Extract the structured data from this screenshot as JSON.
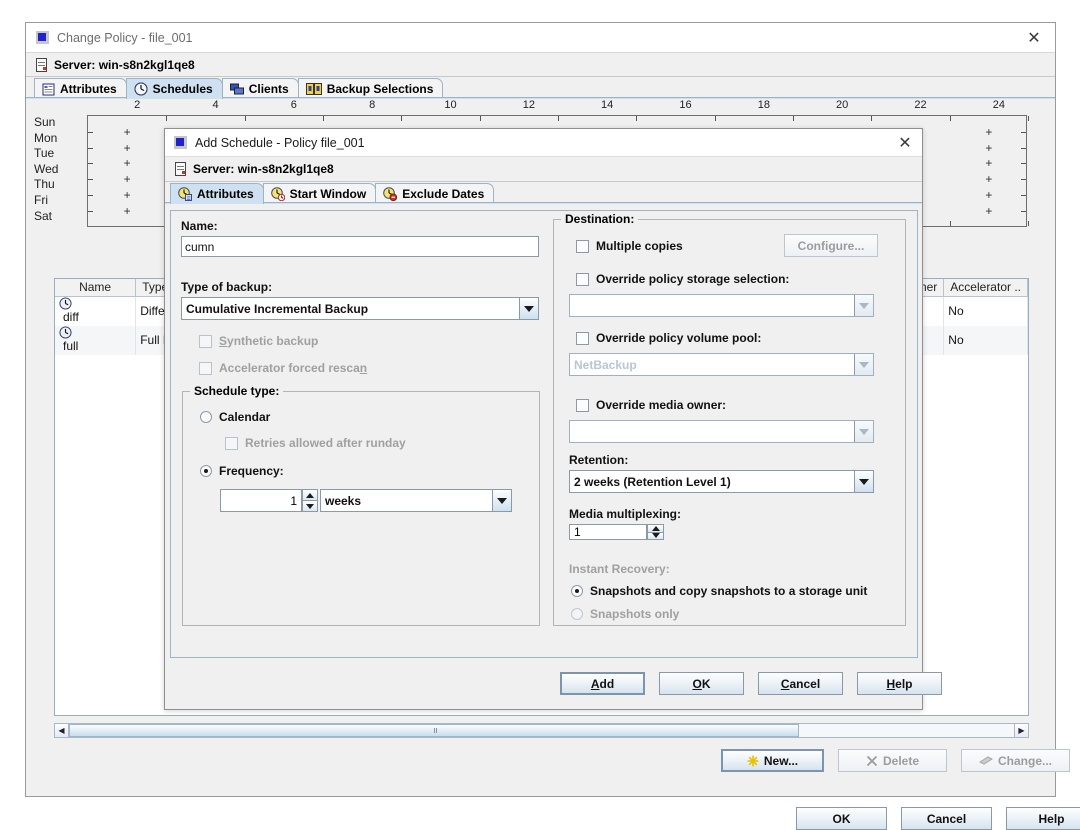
{
  "main_window": {
    "title": "Change Policy - file_001",
    "app_icon": "app-icon",
    "close_icon": "close-icon",
    "server_label": "Server: win-s8n2kgl1qe8",
    "server_icon": "server-icon",
    "tabs": [
      {
        "label": "Attributes",
        "icon": "attributes-icon",
        "active": false
      },
      {
        "label": "Schedules",
        "icon": "schedules-clock-icon",
        "active": true
      },
      {
        "label": "Clients",
        "icon": "clients-icon",
        "active": false
      },
      {
        "label": "Backup Selections",
        "icon": "backup-selections-icon",
        "active": false
      }
    ],
    "grid": {
      "hour_ticks": [
        "2",
        "4",
        "6",
        "8",
        "10",
        "12",
        "14",
        "16",
        "18",
        "20",
        "22",
        "24"
      ],
      "days": [
        "Sun",
        "Mon",
        "Tue",
        "Wed",
        "Thu",
        "Fri",
        "Sat"
      ]
    },
    "table": {
      "columns": [
        "Name",
        "Type",
        "Owner",
        "Accelerator .."
      ],
      "rows": [
        {
          "name": "diff",
          "type": "Differe",
          "owner": "",
          "accelerator": "No",
          "icon": "schedule-clock-icon"
        },
        {
          "name": "full",
          "type": "Full Ba",
          "owner": "",
          "accelerator": "No",
          "icon": "schedule-clock-icon"
        }
      ]
    },
    "scrollbar": {
      "left_icon": "scroll-left-arrow-icon",
      "right_icon": "scroll-right-arrow-icon"
    },
    "schedule_buttons": [
      {
        "label": "New...",
        "key": "N",
        "icon": "new-star-icon",
        "enabled": true
      },
      {
        "label": "Delete",
        "key": "D",
        "icon": "delete-x-icon",
        "enabled": false
      },
      {
        "label": "Change...",
        "key": "e",
        "icon": "change-icon",
        "enabled": false
      }
    ],
    "footer_buttons": [
      {
        "label": "OK",
        "key": "O",
        "enabled": true
      },
      {
        "label": "Cancel",
        "key": "C",
        "enabled": true
      },
      {
        "label": "Help",
        "key": "H",
        "enabled": true
      }
    ]
  },
  "dialog": {
    "title": "Add Schedule - Policy file_001",
    "app_icon": "app-icon",
    "close_icon": "close-icon",
    "server_label": "Server: win-s8n2kgl1qe8",
    "server_icon": "server-icon",
    "tabs": [
      {
        "label": "Attributes",
        "icon": "attributes-clock-icon",
        "active": true
      },
      {
        "label": "Start Window",
        "icon": "start-window-clock-icon",
        "active": false
      },
      {
        "label": "Exclude Dates",
        "icon": "exclude-dates-clock-icon",
        "active": false
      }
    ],
    "left": {
      "name_label": "Name:",
      "name_value": "cumn",
      "name_placeholder": "",
      "type_label": "Type of backup:",
      "type_value": "Cumulative Incremental Backup",
      "synthetic_backup": {
        "label": "Synthetic backup",
        "checked": false,
        "enabled": false
      },
      "accelerator_rescan": {
        "label": "Accelerator forced rescan",
        "checked": false,
        "enabled": false
      },
      "schedule_type": {
        "legend": "Schedule type:",
        "calendar": {
          "label": "Calendar",
          "selected": false,
          "enabled": true
        },
        "retries": {
          "label": "Retries allowed after runday",
          "checked": false,
          "enabled": false
        },
        "frequency": {
          "label": "Frequency:",
          "selected": true,
          "enabled": true
        },
        "frequency_value": "1",
        "frequency_unit": "weeks"
      }
    },
    "right": {
      "legend": "Destination:",
      "multiple_copies": {
        "label": "Multiple copies",
        "checked": false,
        "enabled": true
      },
      "configure_button": {
        "label": "Configure...",
        "key": "g",
        "enabled": false
      },
      "override_storage": {
        "label": "Override policy storage selection:",
        "checked": false,
        "enabled": true
      },
      "override_storage_value": "",
      "override_volume_pool": {
        "label": "Override policy volume pool:",
        "checked": false,
        "enabled": true
      },
      "override_volume_pool_value": "NetBackup",
      "override_media_owner": {
        "label": "Override media owner:",
        "checked": false,
        "enabled": true
      },
      "override_media_owner_value": "",
      "retention_label": "Retention:",
      "retention_value": "2 weeks (Retention Level 1)",
      "media_multiplexing_label": "Media multiplexing:",
      "media_multiplexing_value": "1",
      "instant_recovery_label": "Instant Recovery:",
      "ir_snapshots_copy": {
        "label": "Snapshots and copy snapshots to a storage unit",
        "selected": true,
        "enabled": true
      },
      "ir_snapshots_only": {
        "label": "Snapshots only",
        "selected": false,
        "enabled": false
      }
    },
    "buttons": [
      {
        "label": "Add",
        "key": "A",
        "default": true
      },
      {
        "label": "OK",
        "key": "O",
        "default": false
      },
      {
        "label": "Cancel",
        "key": "C",
        "default": false
      },
      {
        "label": "Help",
        "key": "H",
        "default": false
      }
    ]
  },
  "colors": {
    "window_bg": "#f0f0f0",
    "tab_active": "#cfe0f0",
    "tab_border": "#9bb4c9",
    "disabled_text": "#a0a0a0",
    "title_text": "#6d6d6d"
  }
}
